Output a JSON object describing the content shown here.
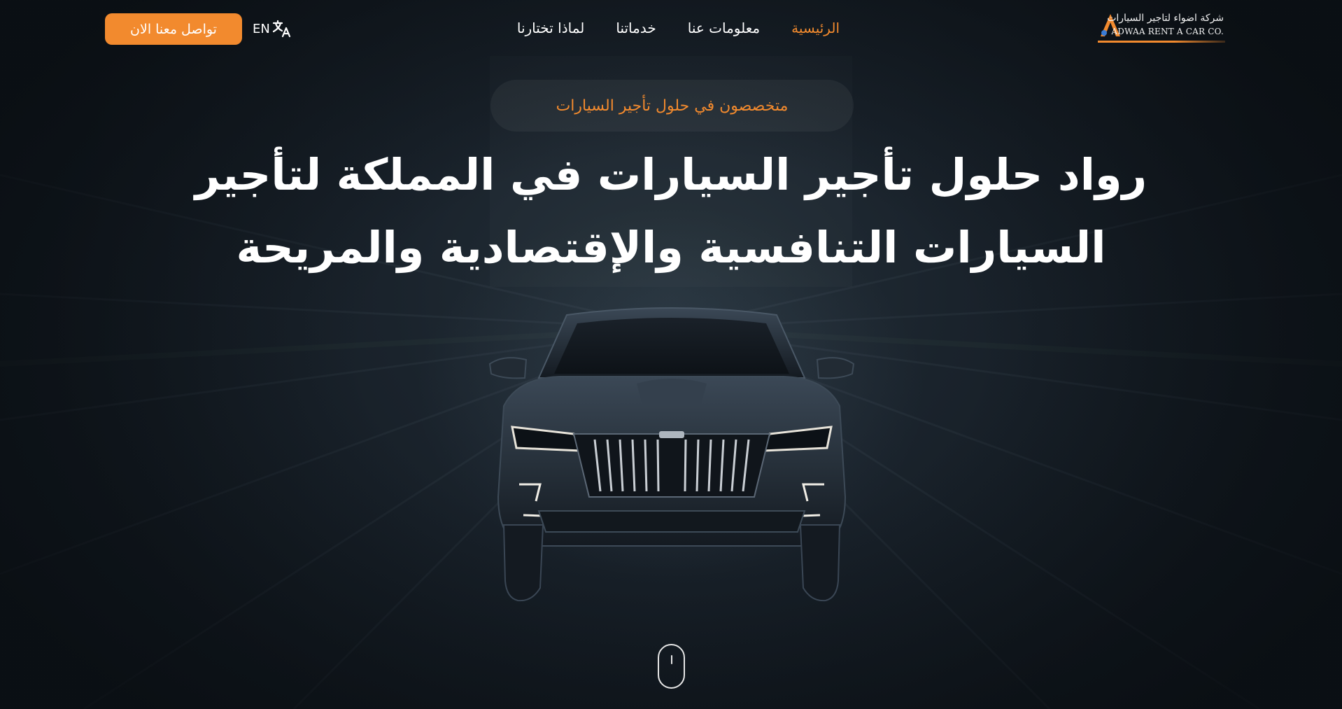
{
  "nav": {
    "cta_label": "تواصل معنا الان",
    "lang_label": "EN",
    "lang_icon": "translate-icon",
    "menu": [
      {
        "label": "الرئيسية",
        "active": true
      },
      {
        "label": "معلومات عنا",
        "active": false
      },
      {
        "label": "خدماتنا",
        "active": false
      },
      {
        "label": "لماذا تختارنا",
        "active": false
      }
    ],
    "logo": {
      "arabic": "شركة اضواء لتاجير السيارات",
      "english": "ADWAA RENT A CAR CO."
    }
  },
  "hero": {
    "badge": "متخصصون في حلول تأجير السيارات",
    "headline": "رواد حلول تأجير السيارات في المملكة لتأجير السيارات التنافسية والإقتصادية والمريحة",
    "scroll_icon": "mouse-scroll-icon"
  },
  "colors": {
    "accent": "#f28a2e",
    "background": "#151c24",
    "text": "#ffffff"
  }
}
